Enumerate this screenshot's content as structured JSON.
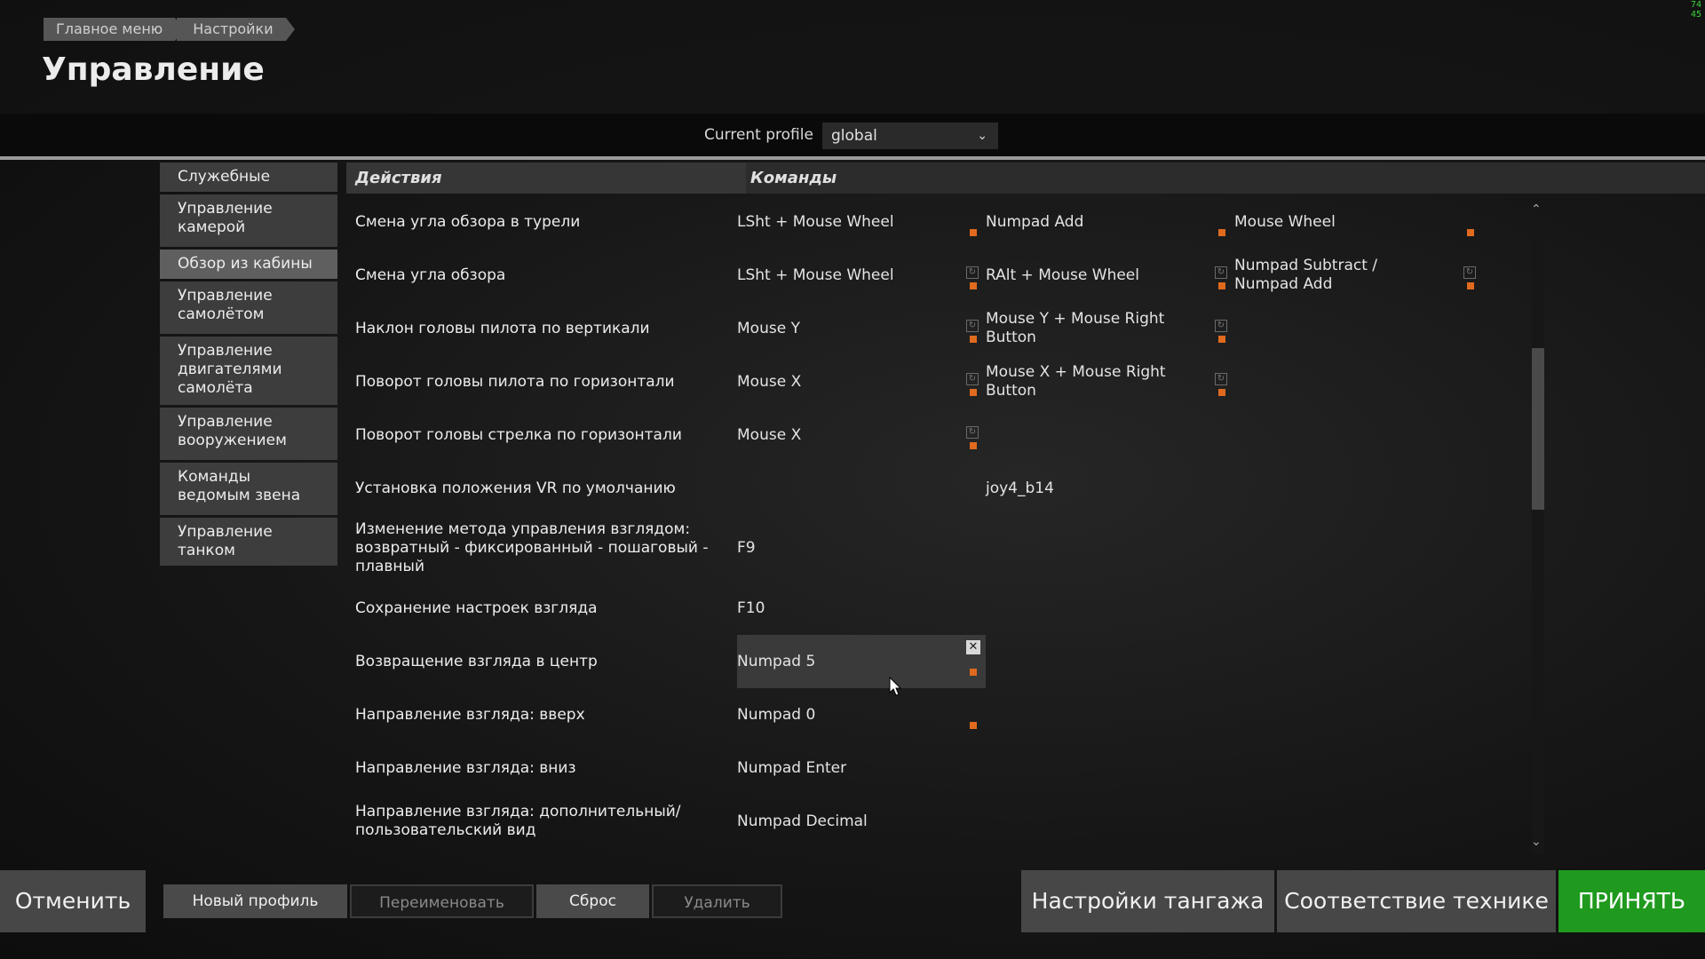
{
  "breadcrumb": [
    "Главное меню",
    "Настройки"
  ],
  "page_title": "Управление",
  "fps": [
    "74",
    "45"
  ],
  "profile": {
    "label": "Current profile",
    "value": "global"
  },
  "sidebar": [
    {
      "label": "Служебные",
      "active": false
    },
    {
      "label": "Управление камерой",
      "active": false
    },
    {
      "label": "Обзор из кабины",
      "active": true
    },
    {
      "label": "Управление самолётом",
      "active": false
    },
    {
      "label": "Управление двигателями самолёта",
      "active": false
    },
    {
      "label": "Управление вооружением",
      "active": false
    },
    {
      "label": "Команды ведомым звена",
      "active": false
    },
    {
      "label": "Управление танком",
      "active": false
    }
  ],
  "table": {
    "header_actions": "Действия",
    "header_commands": "Команды",
    "rows": [
      {
        "action": "Смена угла обзора в турели",
        "c1": "LSht + Mouse Wheel",
        "c2": "Numpad Add",
        "c3": "Mouse Wheel"
      },
      {
        "action": "Смена угла обзора",
        "c1": "LSht + Mouse Wheel",
        "c2": "RAlt + Mouse Wheel",
        "c3": "Numpad Subtract / Numpad Add"
      },
      {
        "action": "Наклон головы пилота по вертикали",
        "c1": "Mouse Y",
        "c2": "Mouse Y + Mouse Right Button",
        "c3": ""
      },
      {
        "action": "Поворот головы пилота по горизонтали",
        "c1": "Mouse X",
        "c2": "Mouse X + Mouse Right Button",
        "c3": ""
      },
      {
        "action": "Поворот головы стрелка по горизонтали",
        "c1": "Mouse X",
        "c2": "",
        "c3": ""
      },
      {
        "action": "Установка положения VR по умолчанию",
        "c1": "",
        "c2": "joy4_b14",
        "c3": ""
      },
      {
        "action": "Изменение метода управления взглядом: возвратный - фиксированный - пошаговый - плавный",
        "c1": "F9",
        "c2": "",
        "c3": ""
      },
      {
        "action": "Сохранение настроек взгляда",
        "c1": "F10",
        "c2": "",
        "c3": ""
      },
      {
        "action": "Возвращение взгляда в центр",
        "c1": "Numpad 5",
        "c2": "",
        "c3": ""
      },
      {
        "action": "Направление взгляда: вверх",
        "c1": "Numpad 0",
        "c2": "",
        "c3": ""
      },
      {
        "action": "Направление взгляда: вниз",
        "c1": "Numpad Enter",
        "c2": "",
        "c3": ""
      },
      {
        "action": "Направление взгляда: дополнительный/пользовательский вид",
        "c1": "Numpad Decimal",
        "c2": "",
        "c3": ""
      }
    ]
  },
  "buttons": {
    "cancel": "Отменить",
    "new_profile": "Новый профиль",
    "rename": "Переименовать",
    "reset": "Сброс",
    "delete": "Удалить",
    "pitch_settings": "Настройки тангажа",
    "tech_match": "Соответствие технике",
    "accept": "ПРИНЯТЬ"
  },
  "colors": {
    "accent_accept": "#1f9a1f",
    "modifier_marker": "#e06a1e"
  }
}
